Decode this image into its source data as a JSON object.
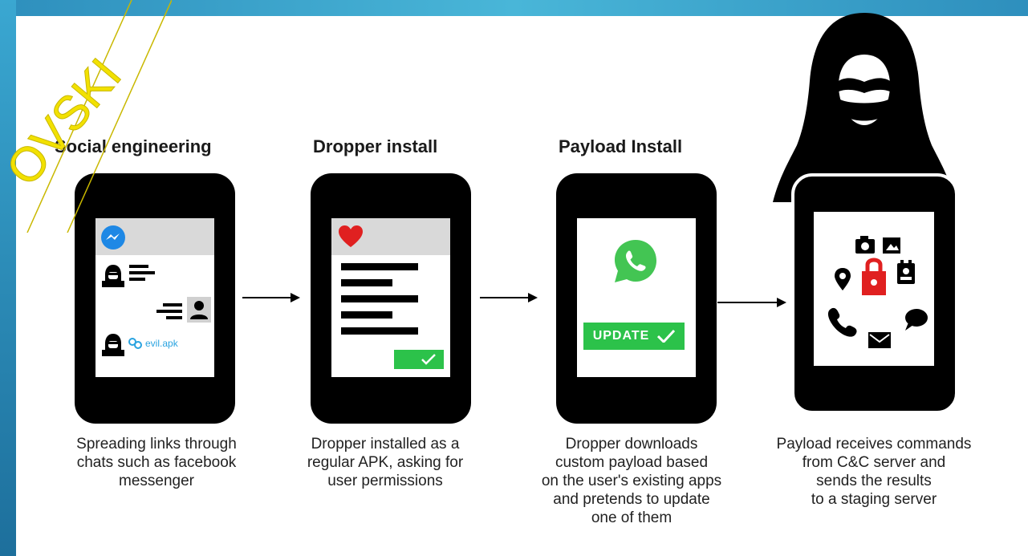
{
  "watermark_text": "OVSKI",
  "steps": [
    {
      "title": "Social engineering",
      "caption": [
        "Spreading links through",
        "chats such as facebook",
        "messenger"
      ],
      "link_text": "evil.apk"
    },
    {
      "title": "Dropper install",
      "caption": [
        "Dropper installed as a",
        "regular APK, asking for",
        "user permissions"
      ]
    },
    {
      "title": "Payload Install",
      "caption": [
        "Dropper downloads",
        "custom payload based",
        "on the user's existing apps",
        "and pretends to update",
        "one of them"
      ],
      "button_label": "UPDATE"
    },
    {
      "title": "",
      "caption": [
        "Payload receives commands",
        "from C&C server and",
        "sends the results",
        "to a staging server"
      ]
    }
  ],
  "colors": {
    "accent_green": "#2cc24a",
    "heart_red": "#e02020",
    "lock_red": "#e02020",
    "messenger_blue": "#1e88e5",
    "link_blue": "#29a3e0",
    "whatsapp_green": "#43c553",
    "frame_blue": "#3aa7d1"
  }
}
